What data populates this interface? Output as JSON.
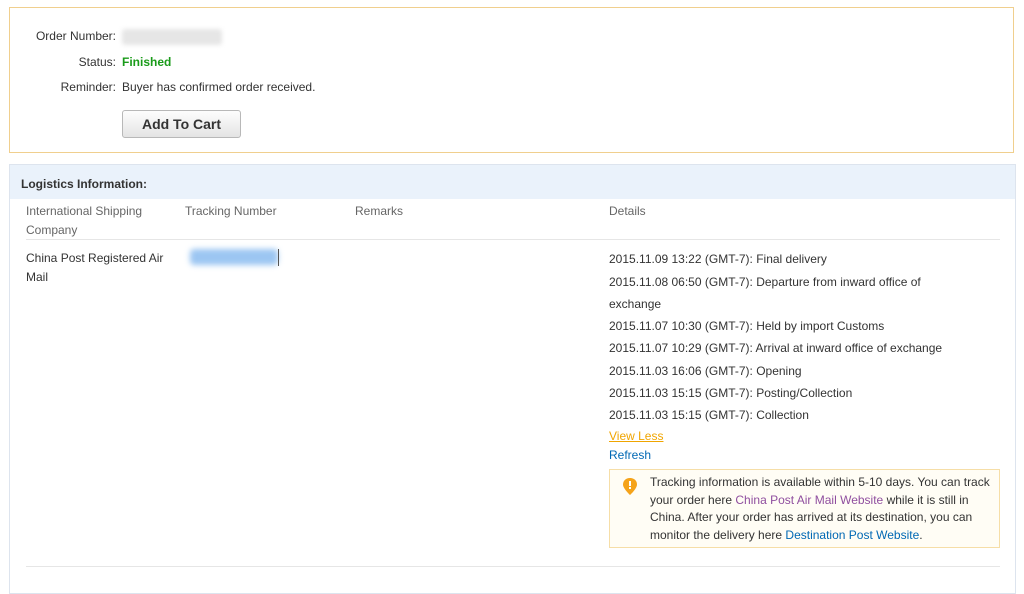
{
  "order": {
    "order_number_label": "Order Number:",
    "status_label": "Status:",
    "status_value": "Finished",
    "reminder_label": "Reminder:",
    "reminder_value": "Buyer has confirmed order received.",
    "add_to_cart_label": "Add To Cart"
  },
  "logistics": {
    "title": "Logistics Information:",
    "headers": {
      "company": "International Shipping Company",
      "tracking": "Tracking Number",
      "remarks": "Remarks",
      "details": "Details"
    },
    "row": {
      "company": "China Post Registered Air Mail",
      "details": [
        "2015.11.09 13:22 (GMT-7): Final delivery",
        "2015.11.08 06:50 (GMT-7): Departure from inward office of",
        "exchange",
        "2015.11.07 10:30 (GMT-7): Held by import Customs",
        "2015.11.07 10:29 (GMT-7): Arrival at inward office of exchange",
        "2015.11.03 16:06 (GMT-7): Opening",
        "2015.11.03 15:15 (GMT-7): Posting/Collection",
        "2015.11.03 15:15 (GMT-7): Collection"
      ],
      "view_less": "View Less",
      "refresh": "Refresh"
    },
    "notice": {
      "text_1": "Tracking information is available within 5-10 days. You can track your order here ",
      "link_1": "China Post Air Mail Website",
      "text_2": " while it is still in China. After your order has arrived at its destination, you can monitor the delivery here ",
      "link_2": "Destination Post Website",
      "text_3": "."
    }
  },
  "colors": {
    "status_green": "#1a9b1a",
    "link_orange": "#f0a500",
    "link_blue": "#0068b4",
    "link_purple": "#8f4e9f",
    "header_bg": "#eaf2fb",
    "order_border": "#f0cf8e"
  },
  "icons": {
    "notice": "location-pin-icon"
  }
}
